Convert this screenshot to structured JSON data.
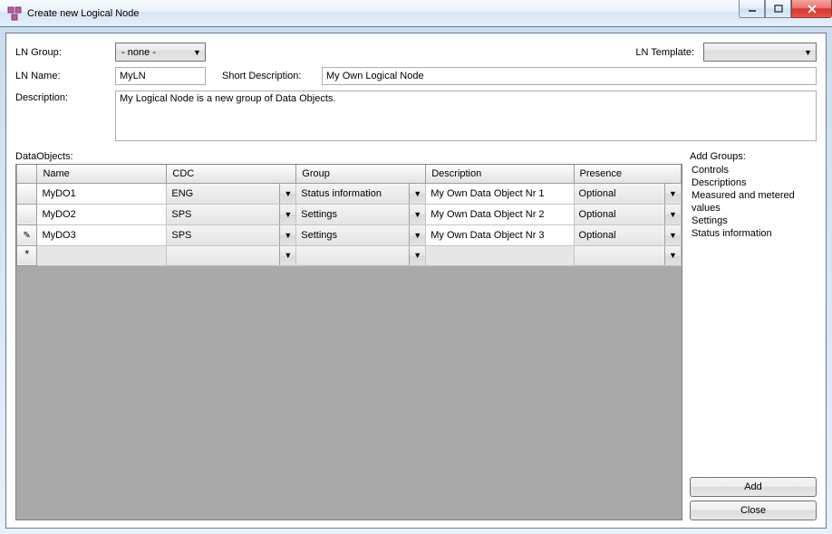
{
  "window": {
    "title": "Create new Logical Node"
  },
  "labels": {
    "ln_group": "LN Group:",
    "ln_template": "LN Template:",
    "ln_name": "LN Name:",
    "short_desc": "Short Description:",
    "description": "Description:",
    "data_objects": "DataObjects:",
    "add_groups": "Add Groups:",
    "add_btn": "Add",
    "close_btn": "Close"
  },
  "form": {
    "ln_group": "- none -",
    "ln_template": "",
    "ln_name": "MyLN",
    "short_desc": "My Own Logical Node",
    "description": "My Logical Node is a new group of Data Objects."
  },
  "columns": {
    "name": "Name",
    "cdc": "CDC",
    "group": "Group",
    "description": "Description",
    "presence": "Presence"
  },
  "rows": [
    {
      "marker": "",
      "name": "MyDO1",
      "cdc": "ENG",
      "group": "Status information",
      "description": "My Own Data Object Nr 1",
      "presence": "Optional"
    },
    {
      "marker": "",
      "name": "MyDO2",
      "cdc": "SPS",
      "group": "Settings",
      "description": "My Own Data Object Nr 2",
      "presence": "Optional"
    },
    {
      "marker": "edit",
      "name": "MyDO3",
      "cdc": "SPS",
      "group": "Settings",
      "description": "My Own Data Object Nr 3",
      "presence": "Optional"
    }
  ],
  "groups": [
    "Controls",
    "Descriptions",
    "Measured and metered values",
    "Settings",
    "Status information"
  ]
}
